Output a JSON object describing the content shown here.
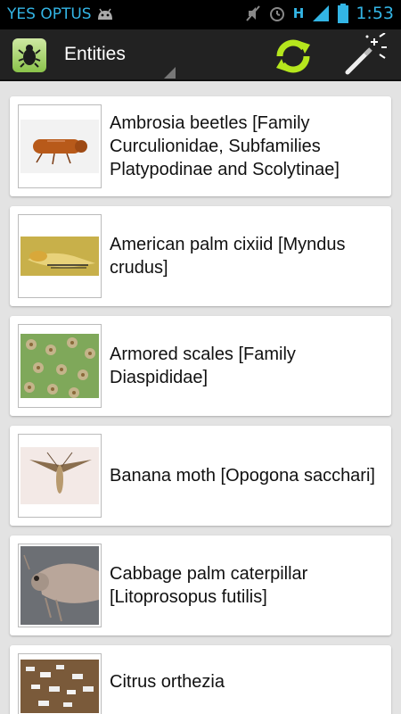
{
  "status_bar": {
    "carrier": "YES OPTUS",
    "network_type": "H",
    "time": "1:53"
  },
  "action_bar": {
    "title": "Entities",
    "app_icon": "beetle-icon",
    "refresh_icon": "refresh-icon",
    "wand_icon": "magic-wand-icon"
  },
  "entities": [
    {
      "label": "Ambrosia beetles [Family Curculionidae, Subfamilies Platypodinae and Scolytinae]"
    },
    {
      "label": "American palm cixiid [Myndus crudus]"
    },
    {
      "label": "Armored scales [Family Diaspididae]"
    },
    {
      "label": "Banana moth [Opogona sacchari]"
    },
    {
      "label": "Cabbage palm caterpillar [Litoprosopus futilis]"
    },
    {
      "label": "Citrus orthezia"
    }
  ],
  "colors": {
    "status_accent": "#33b5e5",
    "action_bar": "#222222",
    "refresh": "#b5e61d",
    "background": "#e3e3e3"
  }
}
